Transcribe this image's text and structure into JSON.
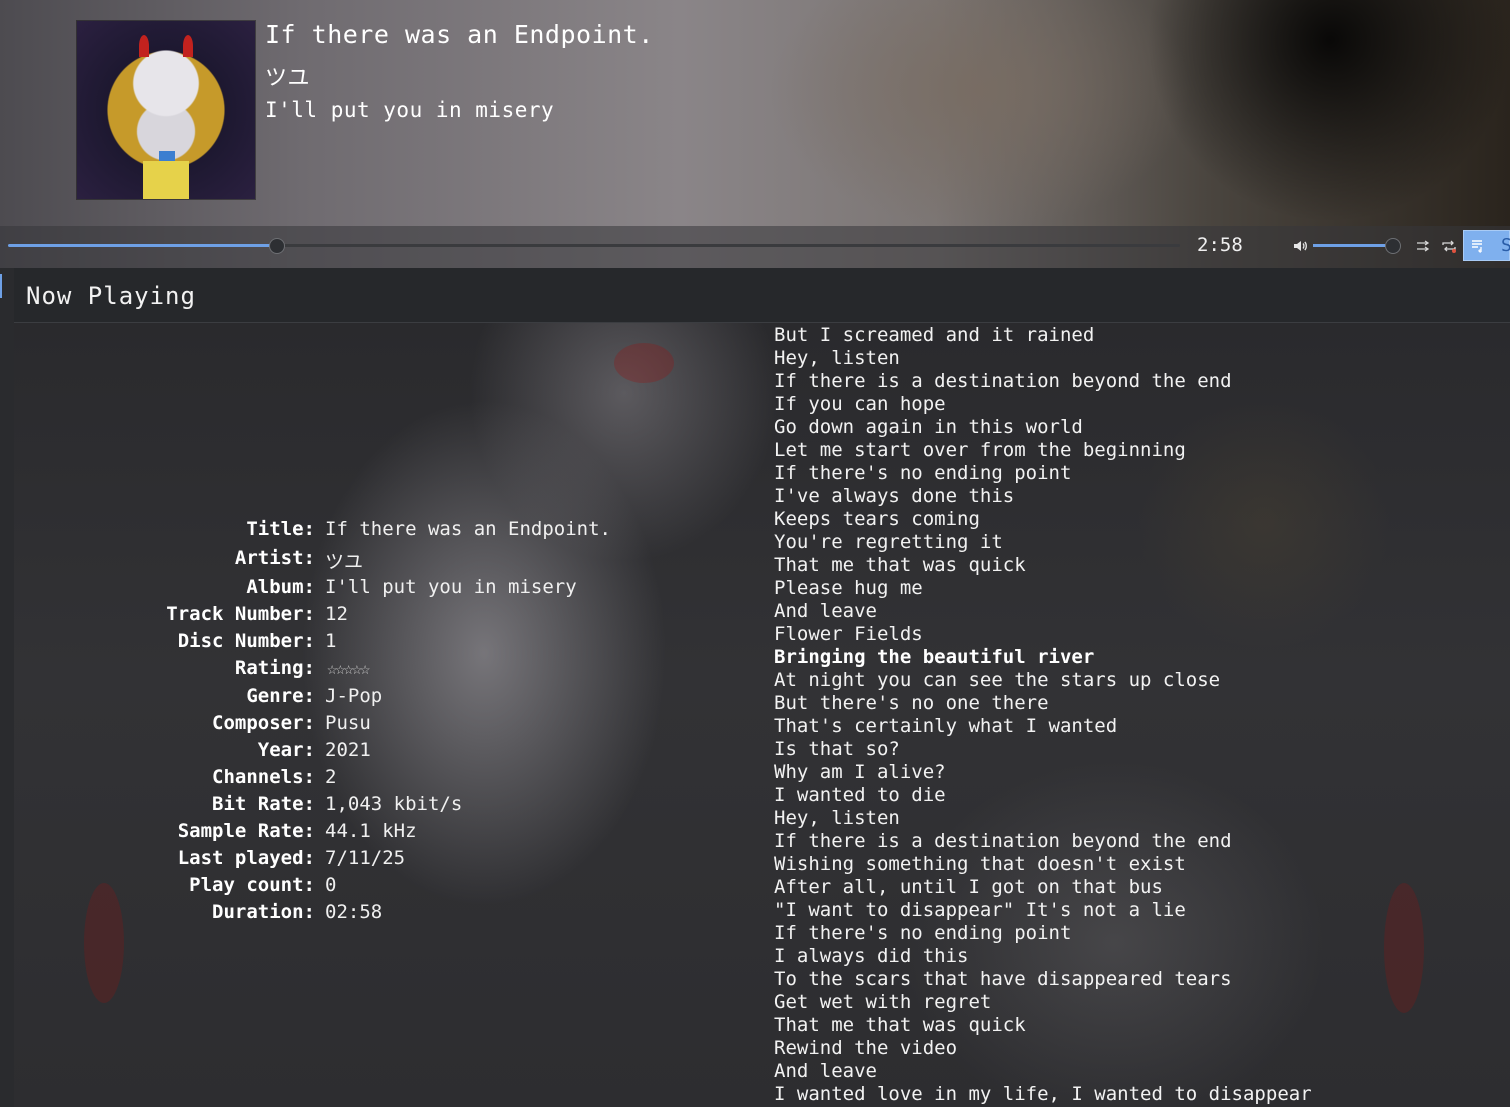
{
  "now_playing": {
    "title": "If there was an Endpoint.",
    "artist": "ツユ",
    "album": "I'll put you in misery"
  },
  "player": {
    "position_fraction": 0.23,
    "time": "2:58",
    "volume_fraction": 0.9,
    "accent_color": "#6ea0e6",
    "lyrics_button_label": "S",
    "icons": [
      "volume-icon",
      "shuffle-icon",
      "repeat-icon",
      "lyrics-icon"
    ]
  },
  "panel": {
    "title": "Now Playing"
  },
  "metadata": [
    {
      "label": "Title:",
      "value": "If there was an Endpoint."
    },
    {
      "label": "Artist:",
      "value": "ツユ"
    },
    {
      "label": "Album:",
      "value": "I'll put you in misery"
    },
    {
      "label": "Track Number:",
      "value": "12"
    },
    {
      "label": "Disc Number:",
      "value": "1"
    },
    {
      "label": "Rating:",
      "value": "☆☆☆☆☆",
      "rating": 0
    },
    {
      "label": "Genre:",
      "value": "J-Pop"
    },
    {
      "label": "Composer:",
      "value": "Pusu"
    },
    {
      "label": "Year:",
      "value": "2021"
    },
    {
      "label": "Channels:",
      "value": "2"
    },
    {
      "label": "Bit Rate:",
      "value": "1,043 kbit/s"
    },
    {
      "label": "Sample Rate:",
      "value": "44.1 kHz"
    },
    {
      "label": "Last played:",
      "value": "7/11/25"
    },
    {
      "label": "Play count:",
      "value": "0"
    },
    {
      "label": "Duration:",
      "value": "02:58"
    }
  ],
  "lyrics": {
    "current_index": 14,
    "lines": [
      "But I screamed and it rained",
      "Hey, listen",
      "If there is a destination beyond the end",
      "If you can hope",
      "Go down again in this world",
      "Let me start over from the beginning",
      "If there's no ending point",
      "I've always done this",
      "Keeps tears coming",
      "You're regretting it",
      "That me that was quick",
      "Please hug me",
      "And leave",
      "Flower Fields",
      "Bringing the beautiful river",
      "At night you can see the stars up close",
      "But there's no one there",
      "That's certainly what I wanted",
      "Is that so?",
      "Why am I alive?",
      "I wanted to die",
      "Hey, listen",
      "If there is a destination beyond the end",
      "Wishing something that doesn't exist",
      "After all, until I got on that bus",
      "\"I want to disappear\" It's not a lie",
      "If there's no ending point",
      "I always did this",
      "To the scars that have disappeared tears",
      "Get wet with regret",
      "That me that was quick",
      "Rewind the video",
      "And leave",
      "I wanted love in my life, I wanted to disappear"
    ]
  }
}
